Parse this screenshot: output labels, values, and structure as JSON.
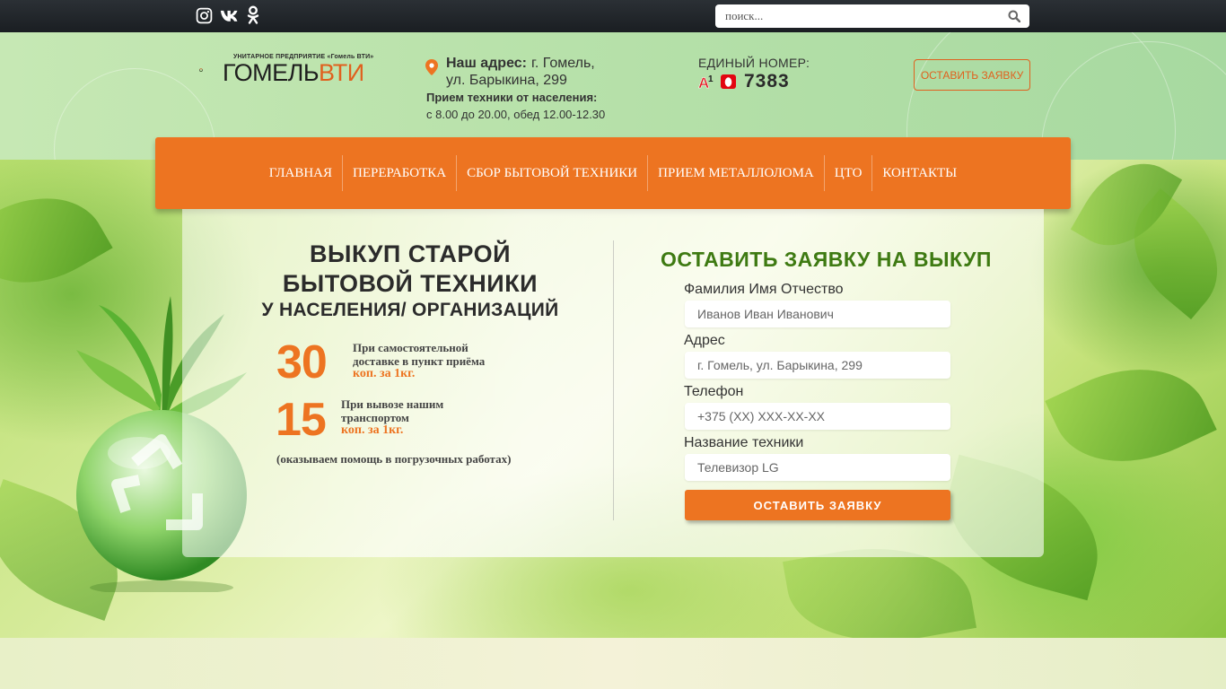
{
  "search": {
    "placeholder": "поиск..."
  },
  "social": {
    "icons": [
      "instagram-icon",
      "vk-icon",
      "odnoklassniki-icon"
    ]
  },
  "logo": {
    "small_text": "УНИТАРНОЕ ПРЕДПРИЯТИЕ «Гомель ВТИ»",
    "main_text": "ГОМЕЛЬ",
    "accent_text": "ВТИ"
  },
  "address": {
    "label": "Наш адрес:",
    "line1": "г. Гомель,",
    "line2": "ул. Барыкина, 299",
    "hours_label": "Прием техники от населения:",
    "hours": "с 8.00 до 20.00, обед 12.00-12.30"
  },
  "phone": {
    "label": "ЕДИНЫЙ НОМЕР:",
    "number": "7383",
    "operators": [
      "A1",
      "МТС"
    ]
  },
  "header_button": "ОСТАВИТЬ ЗАЯВКУ",
  "nav": {
    "items": [
      "ГЛАВНАЯ",
      "ПЕРЕРАБОТКА",
      "СБОР БЫТОВОЙ ТЕХНИКИ",
      "ПРИЕМ МЕТАЛЛОЛОМА",
      "ЦТО",
      "КОНТАКТЫ"
    ]
  },
  "offer": {
    "title_line1": "ВЫКУП СТАРОЙ",
    "title_line2": "БЫТОВОЙ ТЕХНИКИ",
    "subtitle": "У НАСЕЛЕНИЯ/ ОРГАНИЗАЦИЙ",
    "price1": "30",
    "price1_text": "При самостоятельной доставке в пункт приёма",
    "price1_unit": "коп. за 1кг.",
    "price2": "15",
    "price2_text": "При вывозе нашим транспортом",
    "price2_unit": "коп. за 1кг.",
    "note": "(оказываем помощь в погрузочных работах)"
  },
  "form": {
    "title": "ОСТАВИТЬ ЗАЯВКУ НА ВЫКУП",
    "fields": [
      {
        "label": "Фамилия Имя Отчество",
        "placeholder": "Иванов Иван Иванович"
      },
      {
        "label": "Адрес",
        "placeholder": "г. Гомель, ул. Барыкина, 299"
      },
      {
        "label": "Телефон",
        "placeholder": "+375 (XX) XXX-XX-XX"
      },
      {
        "label": "Название техники",
        "placeholder": "Телевизор LG"
      }
    ],
    "submit": "ОСТАВИТЬ ЗАЯВКУ"
  },
  "colors": {
    "accent": "#ed7421",
    "form_title": "#3e7a12",
    "topbar": "#1f2327"
  }
}
